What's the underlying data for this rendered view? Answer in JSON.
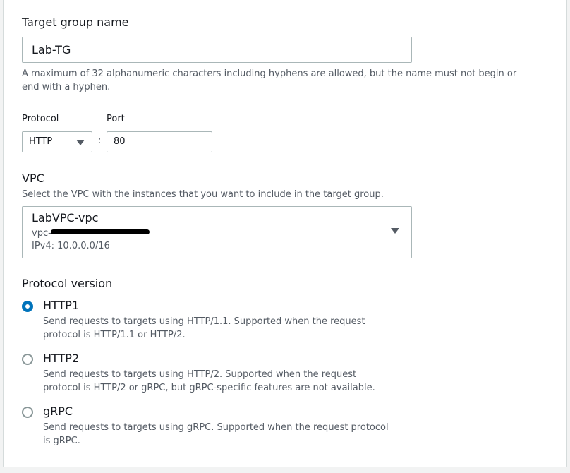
{
  "target_group_name": {
    "label": "Target group name",
    "value": "Lab-TG",
    "hint_line1": "A maximum of 32 alphanumeric characters including hyphens are allowed, but the name must not begin or",
    "hint_line2": "end with a hyphen."
  },
  "protocol": {
    "label": "Protocol",
    "selected": "HTTP"
  },
  "port": {
    "label": "Port",
    "separator": ":",
    "value": "80"
  },
  "vpc": {
    "label": "VPC",
    "hint": "Select the VPC with the instances that you want to include in the target group.",
    "selected_name": "LabVPC-vpc",
    "selected_id_prefix": "vpc-",
    "selected_ipv4": "IPv4: 10.0.0.0/16"
  },
  "protocol_version": {
    "label": "Protocol version",
    "selected": "HTTP1",
    "options": [
      {
        "title": "HTTP1",
        "desc_line1": "Send requests to targets using HTTP/1.1. Supported when the request",
        "desc_line2": "protocol is HTTP/1.1 or HTTP/2."
      },
      {
        "title": "HTTP2",
        "desc_line1": "Send requests to targets using HTTP/2. Supported when the request",
        "desc_line2": "protocol is HTTP/2 or gRPC, but gRPC-specific features are not available."
      },
      {
        "title": "gRPC",
        "desc_line1": "Send requests to targets using gRPC. Supported when the request protocol",
        "desc_line2": "is gRPC."
      }
    ]
  },
  "colors": {
    "accent": "#0073bb",
    "text": "#16191f",
    "secondary_text": "#545b64",
    "border": "#aab7b8",
    "background": "#f2f3f3"
  }
}
